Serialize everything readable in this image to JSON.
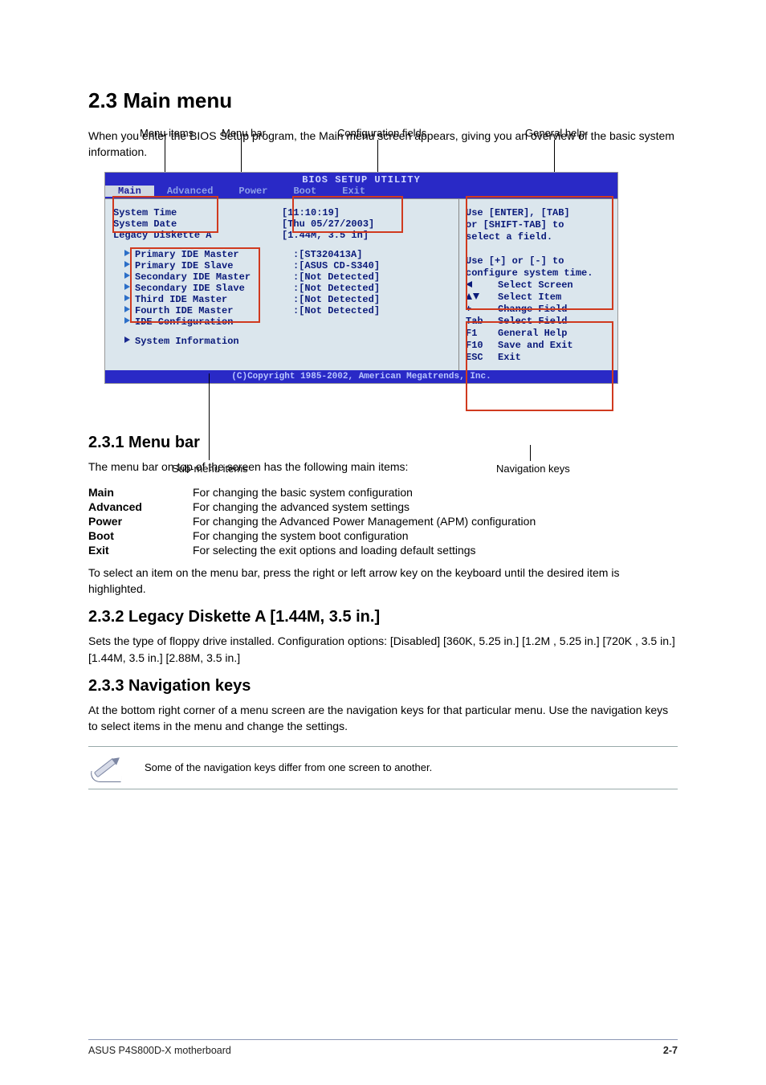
{
  "section_title": "2.3 Main menu",
  "intro": "When you enter the BIOS Setup program, the Main menu screen appears, giving you an overview of the basic system information.",
  "callouts": {
    "menu_items_label": "Menu items",
    "menu_bar_label": "Menu bar",
    "config_fields_label": "Configuration fields",
    "general_help_label": "General help",
    "submenu_items_label": "Sub-menu items",
    "nav_keys_label": "Navigation keys"
  },
  "bios": {
    "title": "BIOS SETUP UTILITY",
    "tabs": [
      "Main",
      "Advanced",
      "Power",
      "Boot",
      "Exit"
    ],
    "active_tab": "Main",
    "rows": [
      {
        "label": "System Time",
        "value": "[11:10:19]"
      },
      {
        "label": "System Date",
        "value": "[Thu 05/27/2003]"
      },
      {
        "label": "Legacy Diskette A",
        "value": "[1.44M, 3.5 in]"
      }
    ],
    "ide_rows": [
      {
        "label": "Primary IDE Master",
        "value": ":[ST320413A]"
      },
      {
        "label": "Primary IDE Slave",
        "value": ":[ASUS CD-S340]"
      },
      {
        "label": "Secondary IDE Master",
        "value": ":[Not Detected]"
      },
      {
        "label": "Secondary IDE Slave",
        "value": ":[Not Detected]"
      },
      {
        "label": "Third IDE Master",
        "value": ":[Not Detected]"
      },
      {
        "label": "Fourth IDE Master",
        "value": ":[Not Detected]"
      }
    ],
    "extra_subs": [
      "IDE Configuration",
      "System Information"
    ],
    "help_top": "Use [ENTER], [TAB]\nor [SHIFT-TAB] to\nselect a field.\n\nUse [+] or [-] to\nconfigure system time.",
    "nav": [
      {
        "key_icon": "left",
        "label": "Select Screen"
      },
      {
        "key_icon": "updown",
        "label": "Select Item"
      },
      {
        "key": "+-",
        "label": "Change Field"
      },
      {
        "key": "Tab",
        "label": "Select Field"
      },
      {
        "key": "F1",
        "label": "General Help"
      },
      {
        "key": "F10",
        "label": "Save and Exit"
      },
      {
        "key": "ESC",
        "label": "Exit"
      }
    ],
    "footer": "(C)Copyright 1985-2002, American Megatrends, Inc."
  },
  "menu_bar": {
    "heading": "2.3.1 Menu bar",
    "intro": "The menu bar on top of the screen has the following main items:",
    "items": [
      {
        "name": "Main",
        "desc": "For changing the basic system configuration"
      },
      {
        "name": "Advanced",
        "desc": "For changing the advanced system settings"
      },
      {
        "name": "Power",
        "desc": "For changing the Advanced Power Management (APM) configuration"
      },
      {
        "name": "Boot",
        "desc": "For changing the system boot configuration"
      },
      {
        "name": "Exit",
        "desc": "For selecting the exit options and loading default settings"
      }
    ],
    "outro": "To select an item on the menu bar, press the right or left arrow key on the keyboard until the desired item is highlighted."
  },
  "legacy": {
    "heading": "2.3.2 Legacy Diskette A [1.44M, 3.5 in.]",
    "body": "Sets the type of floppy drive installed. Configuration options: [Disabled] [360K, 5.25 in.] [1.2M , 5.25 in.] [720K , 3.5 in.] [1.44M, 3.5 in.] [2.88M, 3.5 in.]"
  },
  "nav_keys": {
    "heading": "2.3.3 Navigation keys",
    "body": "At the bottom right corner of a menu screen are the navigation keys for that particular menu. Use the navigation keys to select items in the menu and change the settings."
  },
  "note": "Some of the navigation keys differ from one screen to another.",
  "footer": {
    "left": "ASUS P4S800D-X motherboard",
    "right": "2-7"
  }
}
